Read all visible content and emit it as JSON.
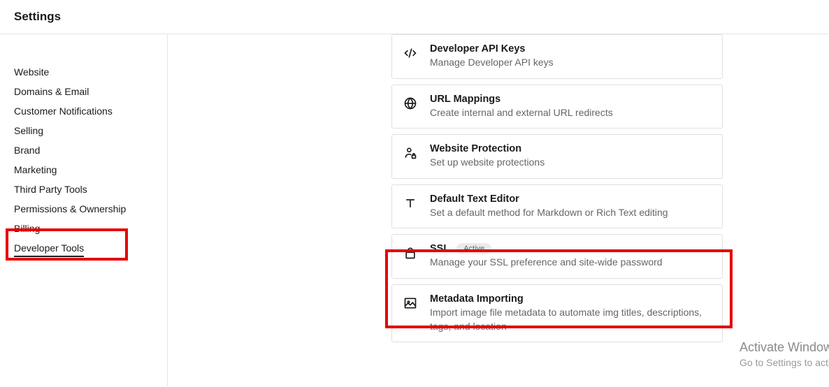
{
  "header": {
    "title": "Settings"
  },
  "sidebar": {
    "items": [
      {
        "label": "Website"
      },
      {
        "label": "Domains & Email"
      },
      {
        "label": "Customer Notifications"
      },
      {
        "label": "Selling"
      },
      {
        "label": "Brand"
      },
      {
        "label": "Marketing"
      },
      {
        "label": "Third Party Tools"
      },
      {
        "label": "Permissions & Ownership"
      },
      {
        "label": "Billing"
      },
      {
        "label": "Developer Tools"
      }
    ]
  },
  "cards": [
    {
      "title": "Developer API Keys",
      "desc": "Manage Developer API keys"
    },
    {
      "title": "URL Mappings",
      "desc": "Create internal and external URL redirects"
    },
    {
      "title": "Website Protection",
      "desc": "Set up website protections"
    },
    {
      "title": "Default Text Editor",
      "desc": "Set a default method for Markdown or Rich Text editing"
    },
    {
      "title": "SSL",
      "badge": "Active",
      "desc": "Manage your SSL preference and site-wide password"
    },
    {
      "title": "Metadata Importing",
      "desc": "Import image file metadata to automate img titles, descriptions, tags, and location"
    }
  ],
  "watermark": {
    "title": "Activate Windows",
    "subtitle": "Go to Settings to activate Windows."
  }
}
